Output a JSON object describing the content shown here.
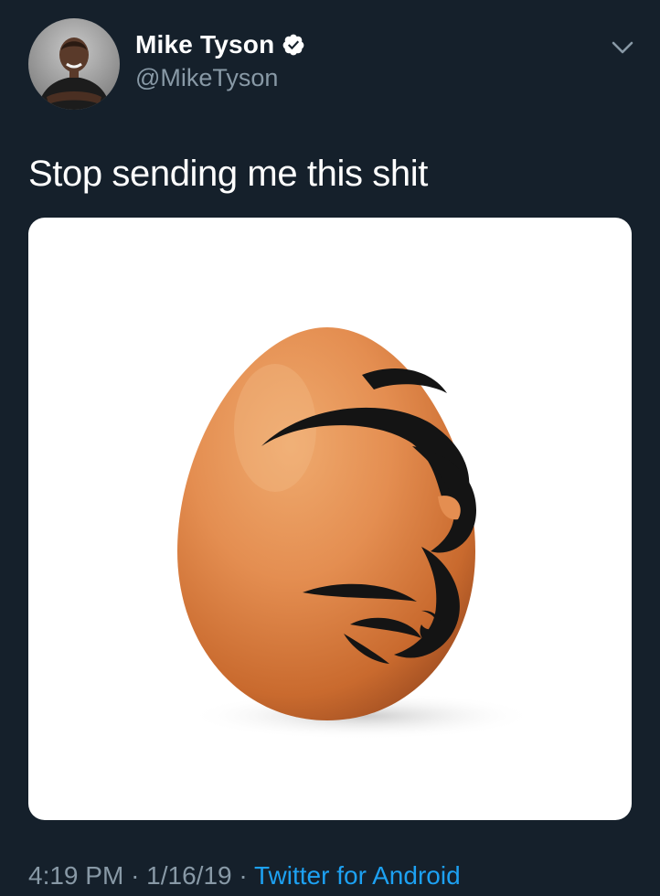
{
  "tweet": {
    "author": {
      "display_name": "Mike Tyson",
      "handle": "@MikeTyson",
      "verified": true,
      "avatar_icon": "profile-photo"
    },
    "text": "Stop sending me this shit",
    "media": {
      "icon": "egg-with-tribal-tattoo-image"
    },
    "timestamp": {
      "time": "4:19 PM",
      "date": "1/16/19",
      "separator": "·",
      "source": "Twitter for Android"
    },
    "menu_icon": "chevron-down-icon"
  },
  "colors": {
    "background": "#15202b",
    "text_primary": "#ffffff",
    "text_secondary": "#8899a6",
    "link": "#1da1f2",
    "verified_badge": "#ffffff"
  }
}
